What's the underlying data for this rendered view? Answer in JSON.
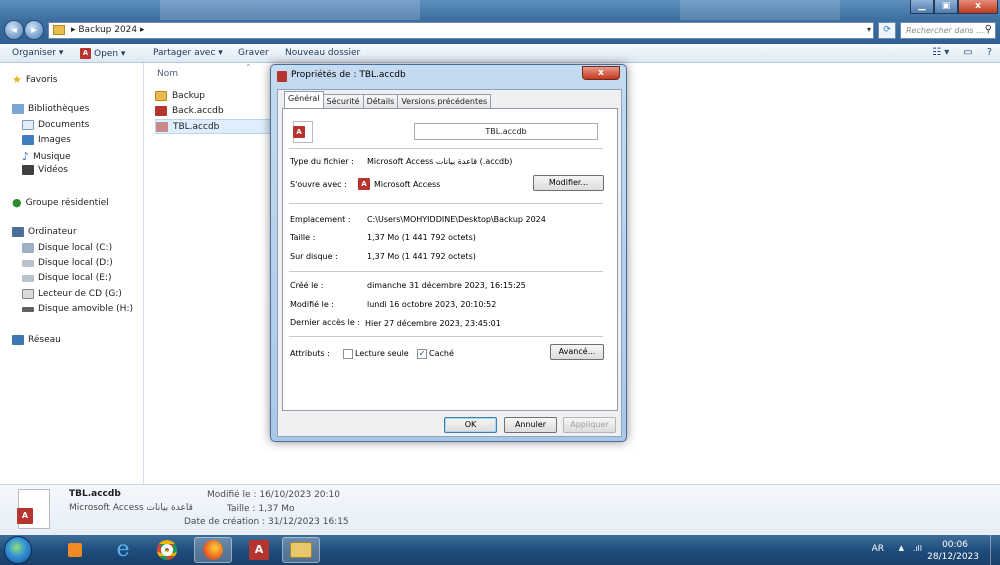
{
  "window": {
    "breadcrumb": "▸ Backup 2024 ▸",
    "search_placeholder": "Rechercher dans ...",
    "controls": {
      "minimize": "▁",
      "maximize": "▣",
      "close": "x"
    }
  },
  "toolbar": {
    "organize": "Organiser ▾",
    "open": "Open ▾",
    "share": "Partager avec ▾",
    "burn": "Graver",
    "new_folder": "Nouveau dossier"
  },
  "navpane": {
    "favorites": "Favoris",
    "libraries": "Bibliothèques",
    "documents": "Documents",
    "images": "Images",
    "music": "Musique",
    "videos": "Vidéos",
    "homegroup": "Groupe résidentiel",
    "computer": "Ordinateur",
    "disk_c": "Disque local (C:)",
    "disk_d": "Disque local (D:)",
    "disk_e": "Disque local (E:)",
    "cd_g": "Lecteur de CD (G:)",
    "removable_h": "Disque amovible (H:)",
    "network": "Réseau"
  },
  "filelist": {
    "column_name": "Nom",
    "files": [
      {
        "name": "Backup"
      },
      {
        "name": "Back.accdb"
      },
      {
        "name": "TBL.accdb"
      }
    ]
  },
  "dialog": {
    "title": "Propriétés de : TBL.accdb",
    "close": "x",
    "tabs": [
      "Général",
      "Sécurité",
      "Détails",
      "Versions précédentes"
    ],
    "filename": "TBL.accdb",
    "type_label": "Type du fichier :",
    "type_value": "Microsoft Access قاعدة بيانات (.accdb)",
    "opens_label": "S'ouvre avec :",
    "opens_value": "Microsoft Access",
    "modify_button": "Modifier...",
    "location_label": "Emplacement :",
    "location_value": "C:\\Users\\MOHYIDDINE\\Desktop\\Backup 2024",
    "size_label": "Taille :",
    "size_value": "1,37 Mo (1 441 792 octets)",
    "disk_label": "Sur disque :",
    "disk_value": "1,37 Mo (1 441 792 octets)",
    "created_label": "Créé le :",
    "created_value": "dimanche 31 décembre 2023, 16:15:25",
    "modified_label": "Modifié le :",
    "modified_value": "lundi 16 octobre 2023, 20:10:52",
    "accessed_label": "Dernier accès le :",
    "accessed_value": "Hier 27 décembre 2023, 23:45:01",
    "attributes_label": "Attributs :",
    "readonly_label": "Lecture seule",
    "hidden_label": "Caché",
    "advanced_button": "Avancé...",
    "ok": "OK",
    "cancel": "Annuler",
    "apply": "Appliquer",
    "icon_letter": "A"
  },
  "details": {
    "name": "TBL.accdb",
    "type": "Microsoft Access قاعدة بيانات",
    "modified": "Modifié le : 16/10/2023 20:10",
    "size": "Taille : 1,37 Mo",
    "created": "Date de création : 31/12/2023 16:15",
    "icon_letter": "A"
  },
  "taskbar": {
    "language": "AR",
    "time": "00:06",
    "date": "28/12/2023"
  },
  "colors": {
    "aero_blue": "#3d6fa1",
    "access_red": "#b5342e",
    "close_red": "#c2381d",
    "selection": "#dfeefc"
  }
}
